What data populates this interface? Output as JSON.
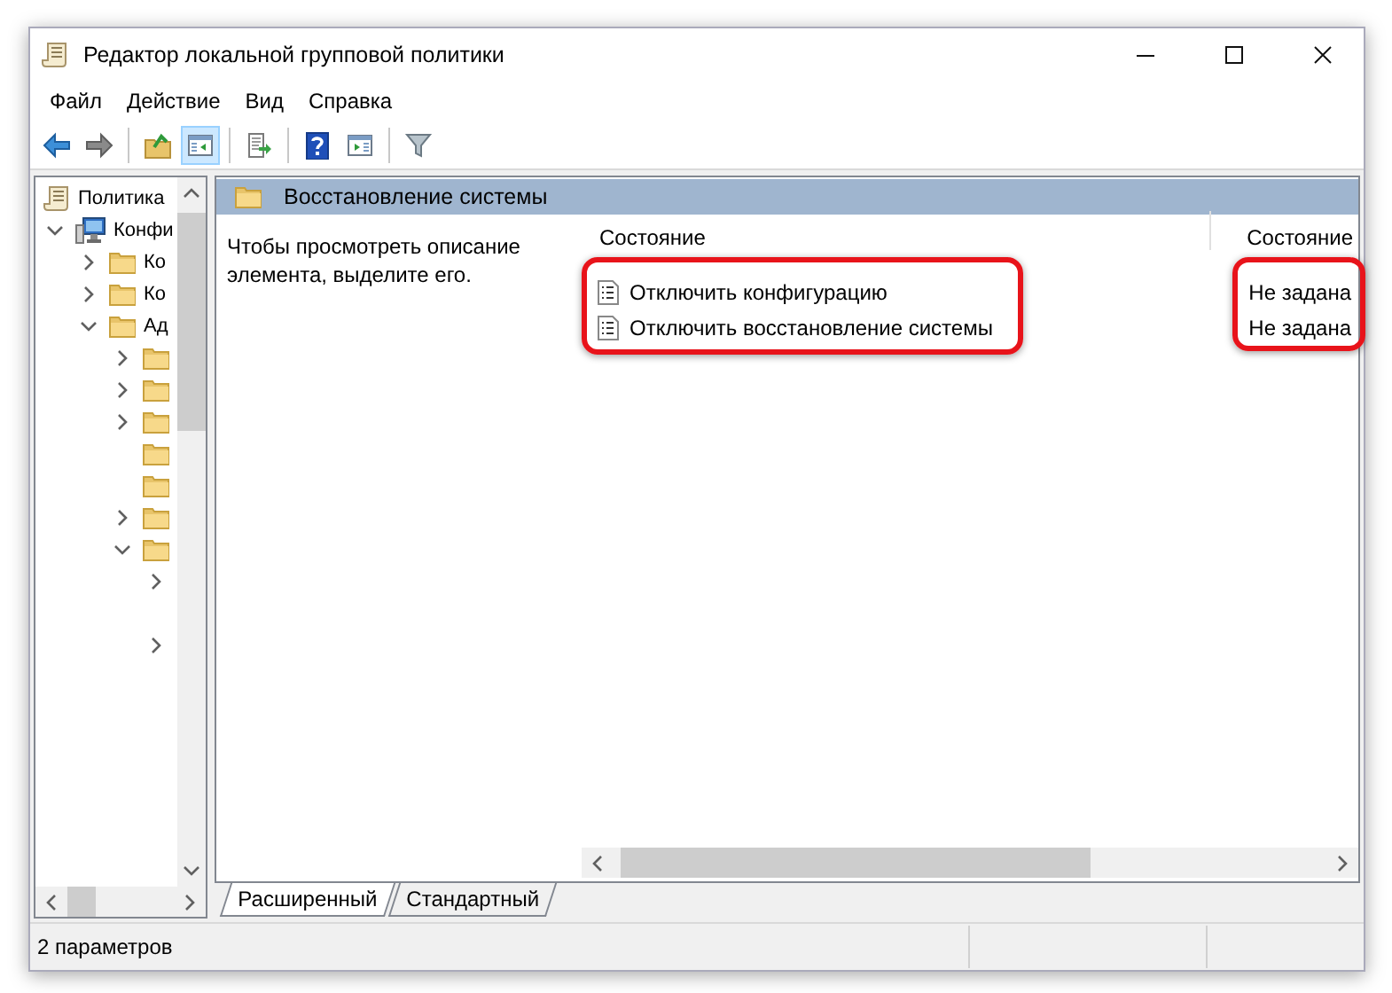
{
  "window": {
    "title": "Редактор локальной групповой политики"
  },
  "menu": [
    "Файл",
    "Действие",
    "Вид",
    "Справка"
  ],
  "toolbar": [
    {
      "kind": "back",
      "pressed": false
    },
    {
      "kind": "forward",
      "pressed": false
    },
    {
      "kind": "separator"
    },
    {
      "kind": "up",
      "pressed": false
    },
    {
      "kind": "tree",
      "pressed": true
    },
    {
      "kind": "separator"
    },
    {
      "kind": "export",
      "pressed": false
    },
    {
      "kind": "separator"
    },
    {
      "kind": "help",
      "pressed": false
    },
    {
      "kind": "pane",
      "pressed": false
    },
    {
      "kind": "separator"
    },
    {
      "kind": "filter",
      "pressed": false
    }
  ],
  "tree": [
    {
      "label": "Политика",
      "kind": "document",
      "children": [
        {
          "label": "Конфи",
          "kind": "computer",
          "expanded": true,
          "children": [
            {
              "label": "Ко",
              "kind": "folder",
              "expanded": false
            },
            {
              "label": "Ко",
              "kind": "folder",
              "expanded": false
            },
            {
              "label": "Ад",
              "kind": "folder",
              "expanded": true,
              "children": [
                {
                  "kind": "folder",
                  "expanded": false
                },
                {
                  "kind": "folder",
                  "expanded": false
                },
                {
                  "kind": "folder",
                  "expanded": false
                },
                {
                  "kind": "folder"
                },
                {
                  "kind": "folder"
                },
                {
                  "kind": "folder",
                  "expanded": false
                },
                {
                  "kind": "folder",
                  "expanded": true,
                  "children": [
                    {
                      "expanded": false
                    },
                    {
                      "expanded": false
                    }
                  ]
                }
              ]
            }
          ]
        }
      ]
    }
  ],
  "details": {
    "title": "Восстановление системы",
    "description": "Чтобы просмотреть описание элемента, выделите его.",
    "columns": [
      "Состояние",
      "Состояние"
    ],
    "rows": [
      {
        "name": "Отключить конфигурацию",
        "state": "Не задана"
      },
      {
        "name": "Отключить восстановление системы",
        "state": "Не задана"
      }
    ]
  },
  "tabs": [
    {
      "label": "Расширенный",
      "selected": true
    },
    {
      "label": "Стандартный",
      "selected": false
    }
  ],
  "status_bar": "2 параметров"
}
